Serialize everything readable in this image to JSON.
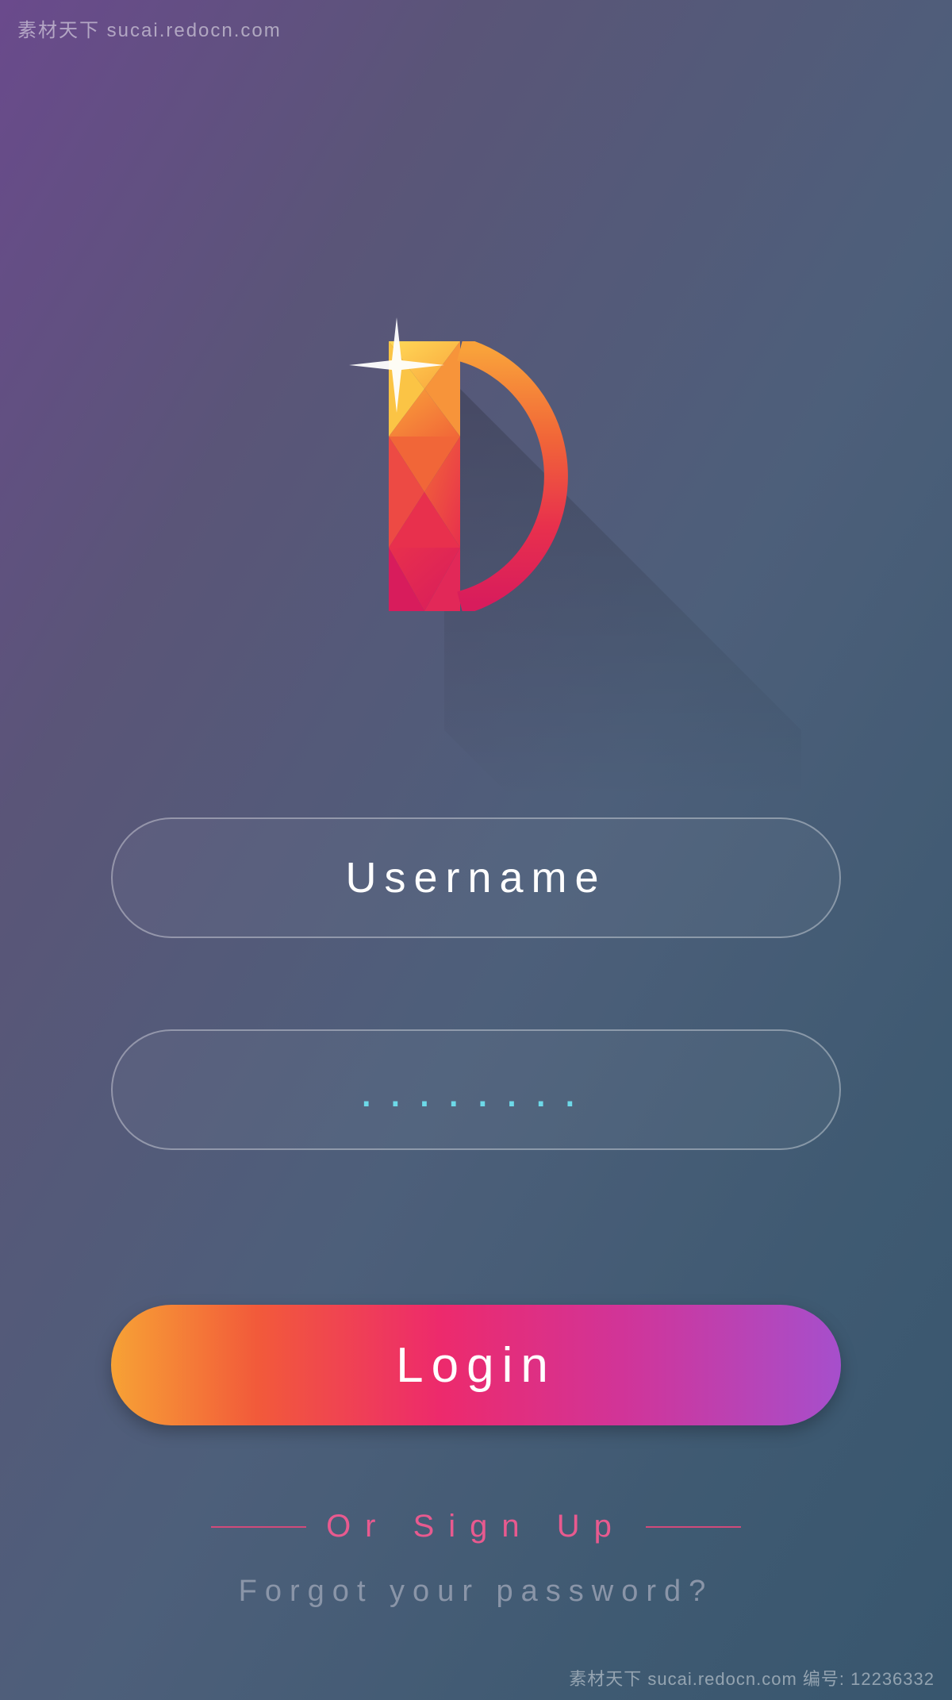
{
  "logo": {
    "letter": "D",
    "icon_name": "app-logo-d-icon"
  },
  "form": {
    "username": {
      "placeholder": "Username",
      "value": ""
    },
    "password": {
      "placeholder": "........",
      "value": ""
    },
    "login_label": "Login"
  },
  "links": {
    "signup_label": "Or Sign Up",
    "forgot_label": "Forgot your password?"
  },
  "watermark": {
    "top_left": "素材天下 sucai.redocn.com",
    "bottom_right": "素材天下 sucai.redocn.com 编号: 12236332"
  },
  "colors": {
    "bg_gradient_start": "#6a4a8c",
    "bg_gradient_end": "#38566e",
    "button_gradient": [
      "#f7a235",
      "#f25a3a",
      "#ed2a6c",
      "#d13498",
      "#a64fcc"
    ],
    "password_dots": "#6dd9e8",
    "signup_accent": "#e85a8f",
    "forgot_muted": "#8a95a8"
  }
}
